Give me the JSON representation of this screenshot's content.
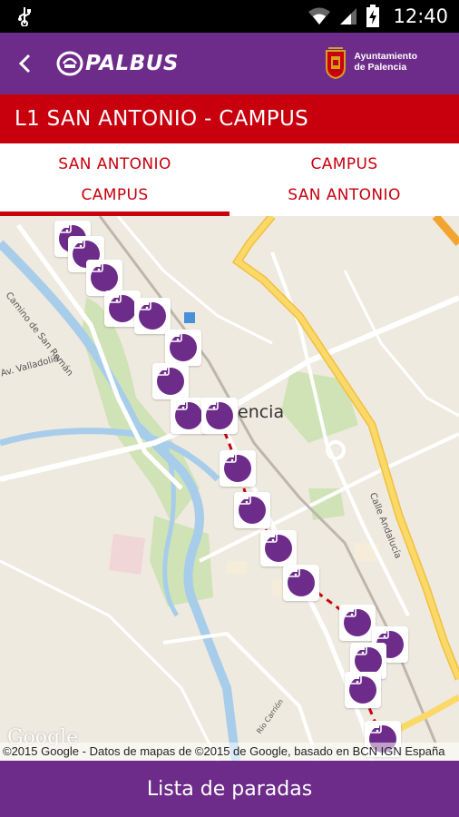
{
  "status_bar": {
    "time": "12:40",
    "icons": [
      "usb-icon",
      "wifi-icon",
      "signal-icon",
      "battery-charging-icon"
    ]
  },
  "app_bar": {
    "back_icon": "chevron-left-icon",
    "logo_text": "PALBUS",
    "municipality_line1": "Ayuntamiento",
    "municipality_line2": "de Palencia",
    "color": "#6d2c8a"
  },
  "line": {
    "title": "L1  SAN ANTONIO - CAMPUS",
    "color": "#c8000e"
  },
  "tabs": [
    {
      "line1": "SAN ANTONIO",
      "line2": "CAMPUS",
      "selected": true
    },
    {
      "line1": "CAMPUS",
      "line2": "SAN ANTONIO",
      "selected": false
    }
  ],
  "map": {
    "city_label": "encia",
    "streets": [
      "Camino de San Román",
      "Av. Valladolid",
      "Calle Andalucía",
      "Río Carrión"
    ],
    "google_logo": "Google",
    "copyright": "©2015 Google - Datos de mapas de ©2015 de Google, basado en BCN IGN España",
    "stop_icon": "bus-stop-icon",
    "stop_count": 20
  },
  "bottom_button": {
    "label": "Lista de paradas"
  }
}
